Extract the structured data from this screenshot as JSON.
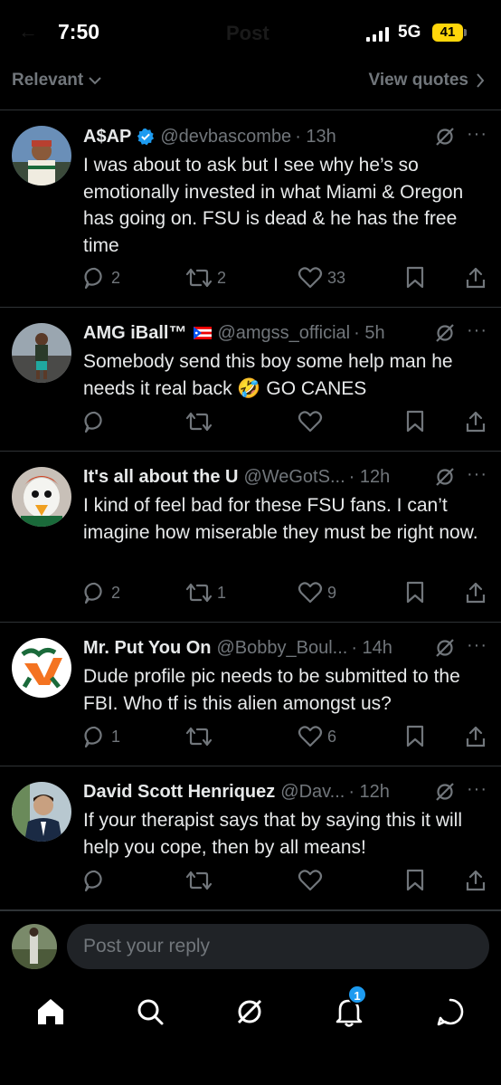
{
  "status_bar": {
    "time": "7:50",
    "network": "5G",
    "battery": "41",
    "ghost_title": "Post",
    "ghost_back": "←"
  },
  "filter": {
    "sort_label": "Relevant",
    "view_quotes_label": "View quotes"
  },
  "replies": [
    {
      "display_name": "A$AP",
      "verified": true,
      "handle": "@devbascombe",
      "time": "· 13h",
      "text": "I was about to ask but I see why he’s so emotionally invested in what Miami & Oregon has going on. FSU is dead & he has the free time",
      "replies": "2",
      "reposts": "2",
      "likes": "33"
    },
    {
      "display_name": "AMG iBall™",
      "flag": "puerto-rico-flag",
      "handle": "@amgss_official",
      "time": "· 5h",
      "text": "Somebody send this boy some help man he needs it real back 🤣 GO CANES",
      "replies": "",
      "reposts": "",
      "likes": ""
    },
    {
      "display_name": "It's all about the U",
      "handle": "@WeGotS...",
      "time": "· 12h",
      "text": "I kind of feel bad for these FSU fans. I can’t imagine how miserable they must be right now.",
      "replies": "2",
      "reposts": "1",
      "likes": "9"
    },
    {
      "display_name": "Mr. Put You On",
      "handle": "@Bobby_Boul...",
      "time": "· 14h",
      "text": "Dude profile pic needs to be submitted to the FBI. Who tf is this alien amongst us?",
      "replies": "1",
      "reposts": "",
      "likes": "6"
    },
    {
      "display_name": "David Scott Henriquez",
      "handle": "@Dav...",
      "time": "· 12h",
      "text": "If your therapist says that by saying this it will help you cope, then by all means!",
      "replies": "",
      "reposts": "",
      "likes": ""
    }
  ],
  "composer": {
    "placeholder": "Post your reply"
  },
  "tabbar": {
    "notifications_badge": "1",
    "icons": [
      "home-icon",
      "search-icon",
      "grok-icon",
      "bell-icon",
      "messages-icon"
    ]
  },
  "colors": {
    "background": "#000000",
    "text": "#e7e9ea",
    "muted": "#71767b",
    "accent": "#1d9bf0",
    "divider": "#2f3336"
  },
  "more_glyph": "···"
}
